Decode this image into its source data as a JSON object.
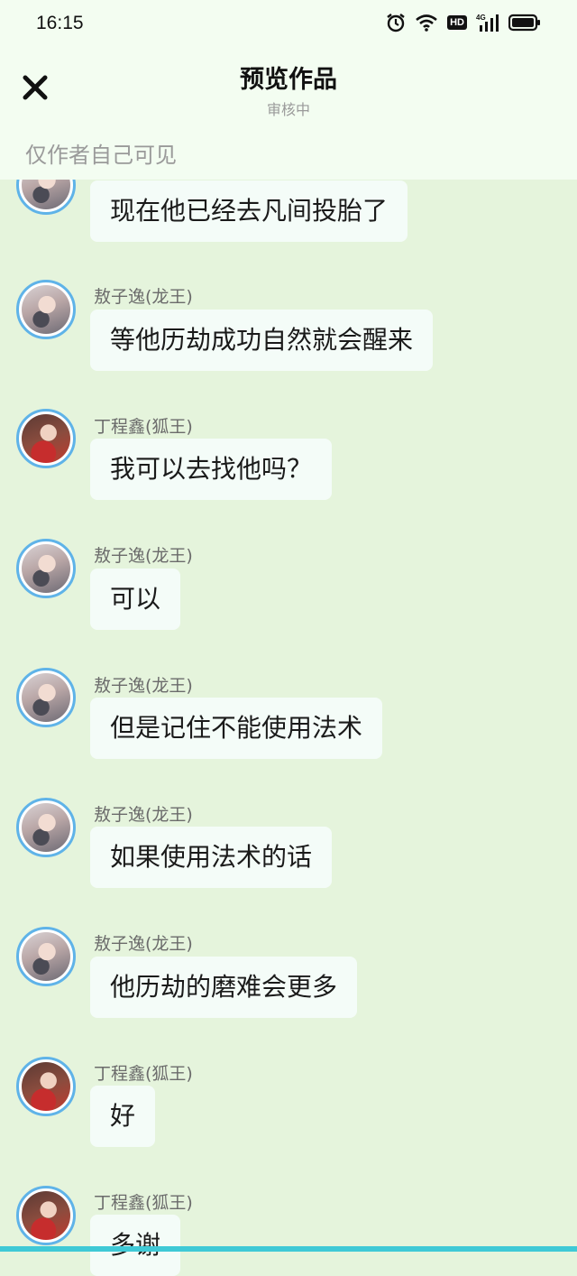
{
  "status_bar": {
    "time": "16:15",
    "icons": [
      "alarm-icon",
      "wifi-icon",
      "hd-icon",
      "signal-4g-icon",
      "battery-icon"
    ],
    "hd_label": "HD",
    "network_label": "4G"
  },
  "header": {
    "title": "预览作品",
    "subtitle": "审核中",
    "close_icon": "close-icon",
    "notice": "仅作者自己可见"
  },
  "colors": {
    "background": "#e5f4dc",
    "header_bg": "#f3fdf1",
    "bubble_bg": "#f4fcf8",
    "avatar_ring": "#5fb3e8",
    "bottom_bar": "#3fc9d6"
  },
  "messages": [
    {
      "speaker": "",
      "text": "现在他已经去凡间投胎了"
    },
    {
      "speaker": "敖子逸(龙王)",
      "text": "等他历劫成功自然就会醒来"
    },
    {
      "speaker": "丁程鑫(狐王)",
      "text": "我可以去找他吗？"
    },
    {
      "speaker": "敖子逸(龙王)",
      "text": "可以"
    },
    {
      "speaker": "敖子逸(龙王)",
      "text": "但是记住不能使用法术"
    },
    {
      "speaker": "敖子逸(龙王)",
      "text": "如果使用法术的话"
    },
    {
      "speaker": "敖子逸(龙王)",
      "text": "他历劫的磨难会更多"
    },
    {
      "speaker": "丁程鑫(狐王)",
      "text": "好"
    },
    {
      "speaker": "丁程鑫(狐王)",
      "text": "多谢"
    }
  ]
}
